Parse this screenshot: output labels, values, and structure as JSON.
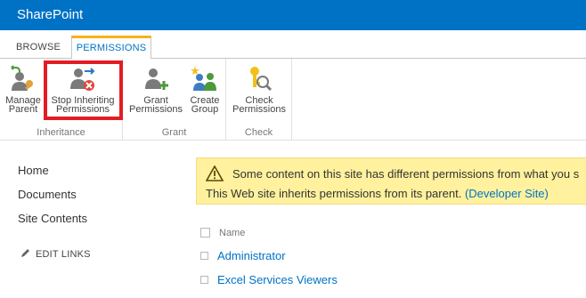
{
  "suite": {
    "brand": "SharePoint"
  },
  "tabs": [
    {
      "label": "BROWSE"
    },
    {
      "label": "PERMISSIONS"
    }
  ],
  "ribbon": {
    "groups": [
      {
        "label": "Inheritance",
        "buttons": [
          {
            "line1": "Manage",
            "line2": "Parent",
            "icon": "manage-parent-icon"
          },
          {
            "line1": "Stop Inheriting",
            "line2": "Permissions",
            "icon": "stop-inheriting-icon"
          }
        ]
      },
      {
        "label": "Grant",
        "buttons": [
          {
            "line1": "Grant",
            "line2": "Permissions",
            "icon": "grant-permissions-icon"
          },
          {
            "line1": "Create",
            "line2": "Group",
            "icon": "create-group-icon"
          }
        ]
      },
      {
        "label": "Check",
        "buttons": [
          {
            "line1": "Check",
            "line2": "Permissions",
            "icon": "check-permissions-icon"
          }
        ]
      }
    ]
  },
  "nav": {
    "items": [
      {
        "label": "Home"
      },
      {
        "label": "Documents"
      },
      {
        "label": "Site Contents"
      }
    ],
    "edit_links": "EDIT LINKS"
  },
  "notice": {
    "line1": "Some content on this site has different permissions from what you s",
    "line2": "This Web site inherits permissions from its parent.",
    "link": "(Developer Site)"
  },
  "list": {
    "header": "Name",
    "rows": [
      {
        "name": "Administrator"
      },
      {
        "name": "Excel Services Viewers"
      }
    ]
  },
  "colors": {
    "suite_bar": "#0072c6",
    "highlight": "#e31c24",
    "notice_bg": "#fff19d",
    "link": "#0072c6"
  }
}
